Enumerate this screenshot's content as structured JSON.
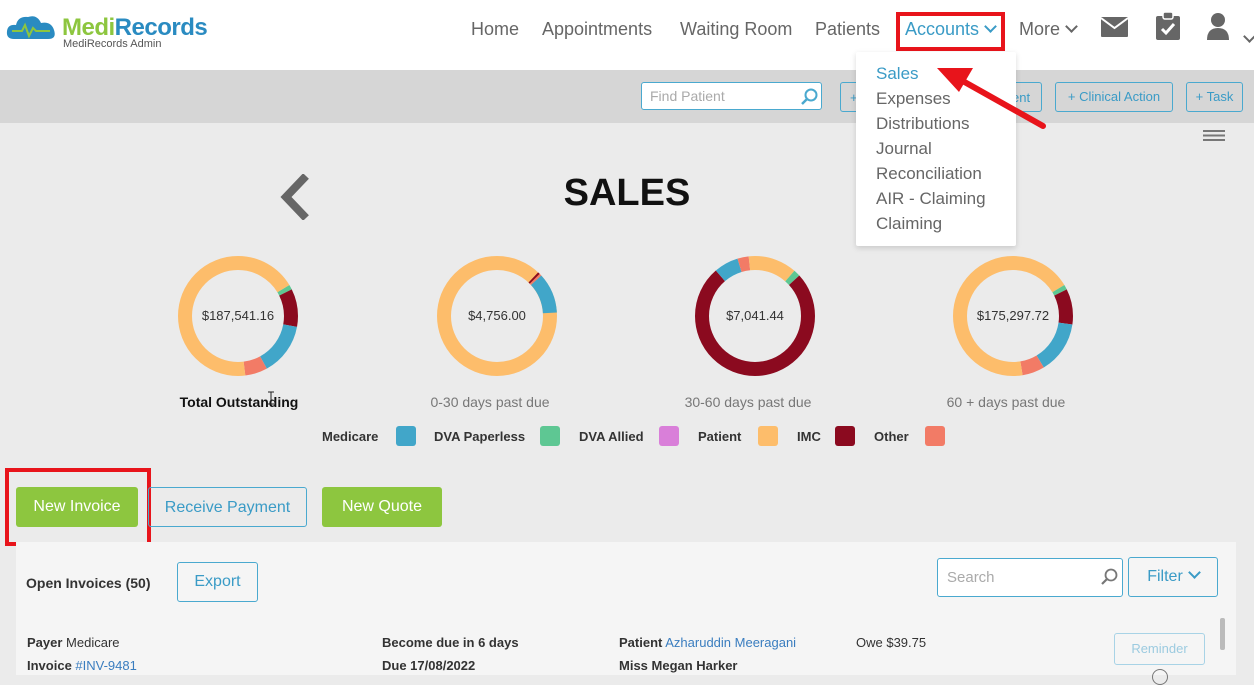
{
  "brand": {
    "name_part1": "Medi",
    "name_part2": "Records",
    "subtitle": "MediRecords Admin"
  },
  "nav": {
    "home": "Home",
    "appointments": "Appointments",
    "waiting_room": "Waiting Room",
    "patients": "Patients",
    "accounts": "Accounts",
    "more": "More"
  },
  "accounts_menu": [
    "Sales",
    "Expenses",
    "Distributions",
    "Journal",
    "Reconciliation",
    "AIR - Claiming",
    "Claiming"
  ],
  "toolbar": {
    "find_patient_placeholder": "Find Patient",
    "hidden_btn_prefix": "+",
    "hidden_btn_suffix": "ent",
    "clinical_action": "+ Clinical Action",
    "task": "+ Task"
  },
  "page": {
    "title": "SALES"
  },
  "donuts": [
    {
      "value": "$187,541.16",
      "label": "Total Outstanding"
    },
    {
      "value": "$4,756.00",
      "label": "0-30 days past due"
    },
    {
      "value": "$7,041.44",
      "label": "30-60 days past due"
    },
    {
      "value": "$175,297.72",
      "label": "60 + days past due"
    }
  ],
  "legend": [
    {
      "label": "Medicare",
      "color": "#41a6c9"
    },
    {
      "label": "DVA Paperless",
      "color": "#5ec793"
    },
    {
      "label": "DVA Allied",
      "color": "#d97fd9"
    },
    {
      "label": "Patient",
      "color": "#fdbd6b"
    },
    {
      "label": "IMC",
      "color": "#8b0a1f"
    },
    {
      "label": "Other",
      "color": "#f27b66"
    }
  ],
  "actions": {
    "new_invoice": "New Invoice",
    "receive_payment": "Receive Payment",
    "new_quote": "New Quote"
  },
  "invoices": {
    "heading": "Open Invoices (50)",
    "export": "Export",
    "search_placeholder": "Search",
    "filter": "Filter",
    "row": {
      "payer_label": "Payer",
      "payer_value": "Medicare",
      "invoice_label": "Invoice",
      "invoice_value": "#INV-9481",
      "due_in": "Become due in 6 days",
      "due_date": "Due 17/08/2022",
      "patient_label": "Patient",
      "patient_value": "Azharuddin Meeragani",
      "patient2": "Miss Megan Harker",
      "owe": "Owe $39.75",
      "reminder": "Reminder"
    }
  }
}
